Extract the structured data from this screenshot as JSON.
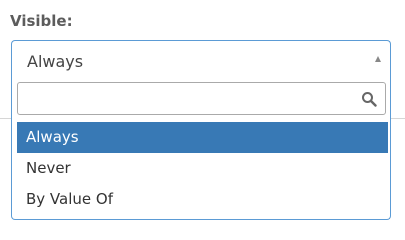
{
  "field": {
    "label": "Visible:",
    "selected": "Always"
  },
  "dropdown": {
    "search_placeholder": "",
    "options": [
      "Always",
      "Never",
      "By Value Of"
    ],
    "highlighted_index": 0
  },
  "colors": {
    "focus_border": "#5b9bd5",
    "highlight": "#3879b5"
  }
}
